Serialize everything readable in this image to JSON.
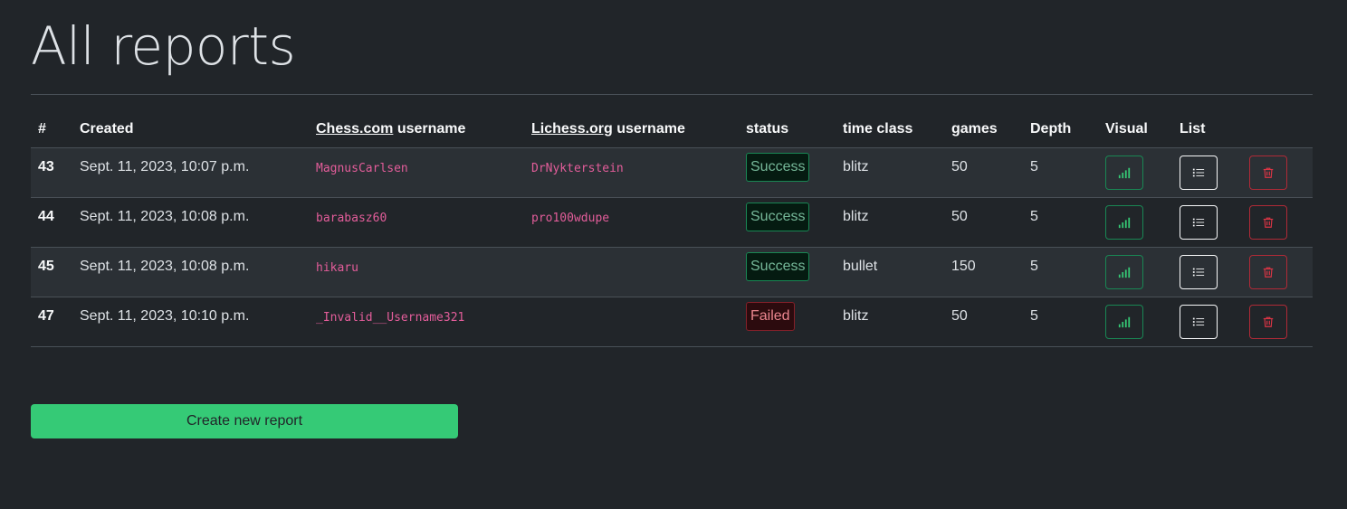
{
  "page_title": "All reports",
  "table": {
    "headers": {
      "num": "#",
      "created": "Created",
      "chesscom_site": "Chess.com",
      "chesscom_suffix": " username",
      "lichess_site": "Lichess.org",
      "lichess_suffix": " username",
      "status": "status",
      "time_class": "time class",
      "games": "games",
      "depth": "Depth",
      "visual": "Visual",
      "list": "List"
    },
    "rows": [
      {
        "num": "43",
        "created": "Sept. 11, 2023, 10:07 p.m.",
        "chesscom": "MagnusCarlsen",
        "lichess": "DrNykterstein",
        "status": "Success",
        "time_class": "blitz",
        "games": "50",
        "depth": "5"
      },
      {
        "num": "44",
        "created": "Sept. 11, 2023, 10:08 p.m.",
        "chesscom": "barabasz60",
        "lichess": "pro100wdupe",
        "status": "Success",
        "time_class": "blitz",
        "games": "50",
        "depth": "5"
      },
      {
        "num": "45",
        "created": "Sept. 11, 2023, 10:08 p.m.",
        "chesscom": "hikaru",
        "lichess": "",
        "status": "Success",
        "time_class": "bullet",
        "games": "150",
        "depth": "5"
      },
      {
        "num": "47",
        "created": "Sept. 11, 2023, 10:10 p.m.",
        "chesscom": "_Invalid__Username321",
        "lichess": "",
        "status": "Failed",
        "time_class": "blitz",
        "games": "50",
        "depth": "5"
      }
    ]
  },
  "icons": {
    "visual": "bar-chart-icon",
    "list": "list-icon",
    "delete": "trash-icon"
  },
  "create_button_label": "Create new report",
  "colors": {
    "background": "#212529",
    "success": "#198754",
    "danger": "#dc3545",
    "accent_button": "#35ca76",
    "username": "#e35d9a"
  }
}
